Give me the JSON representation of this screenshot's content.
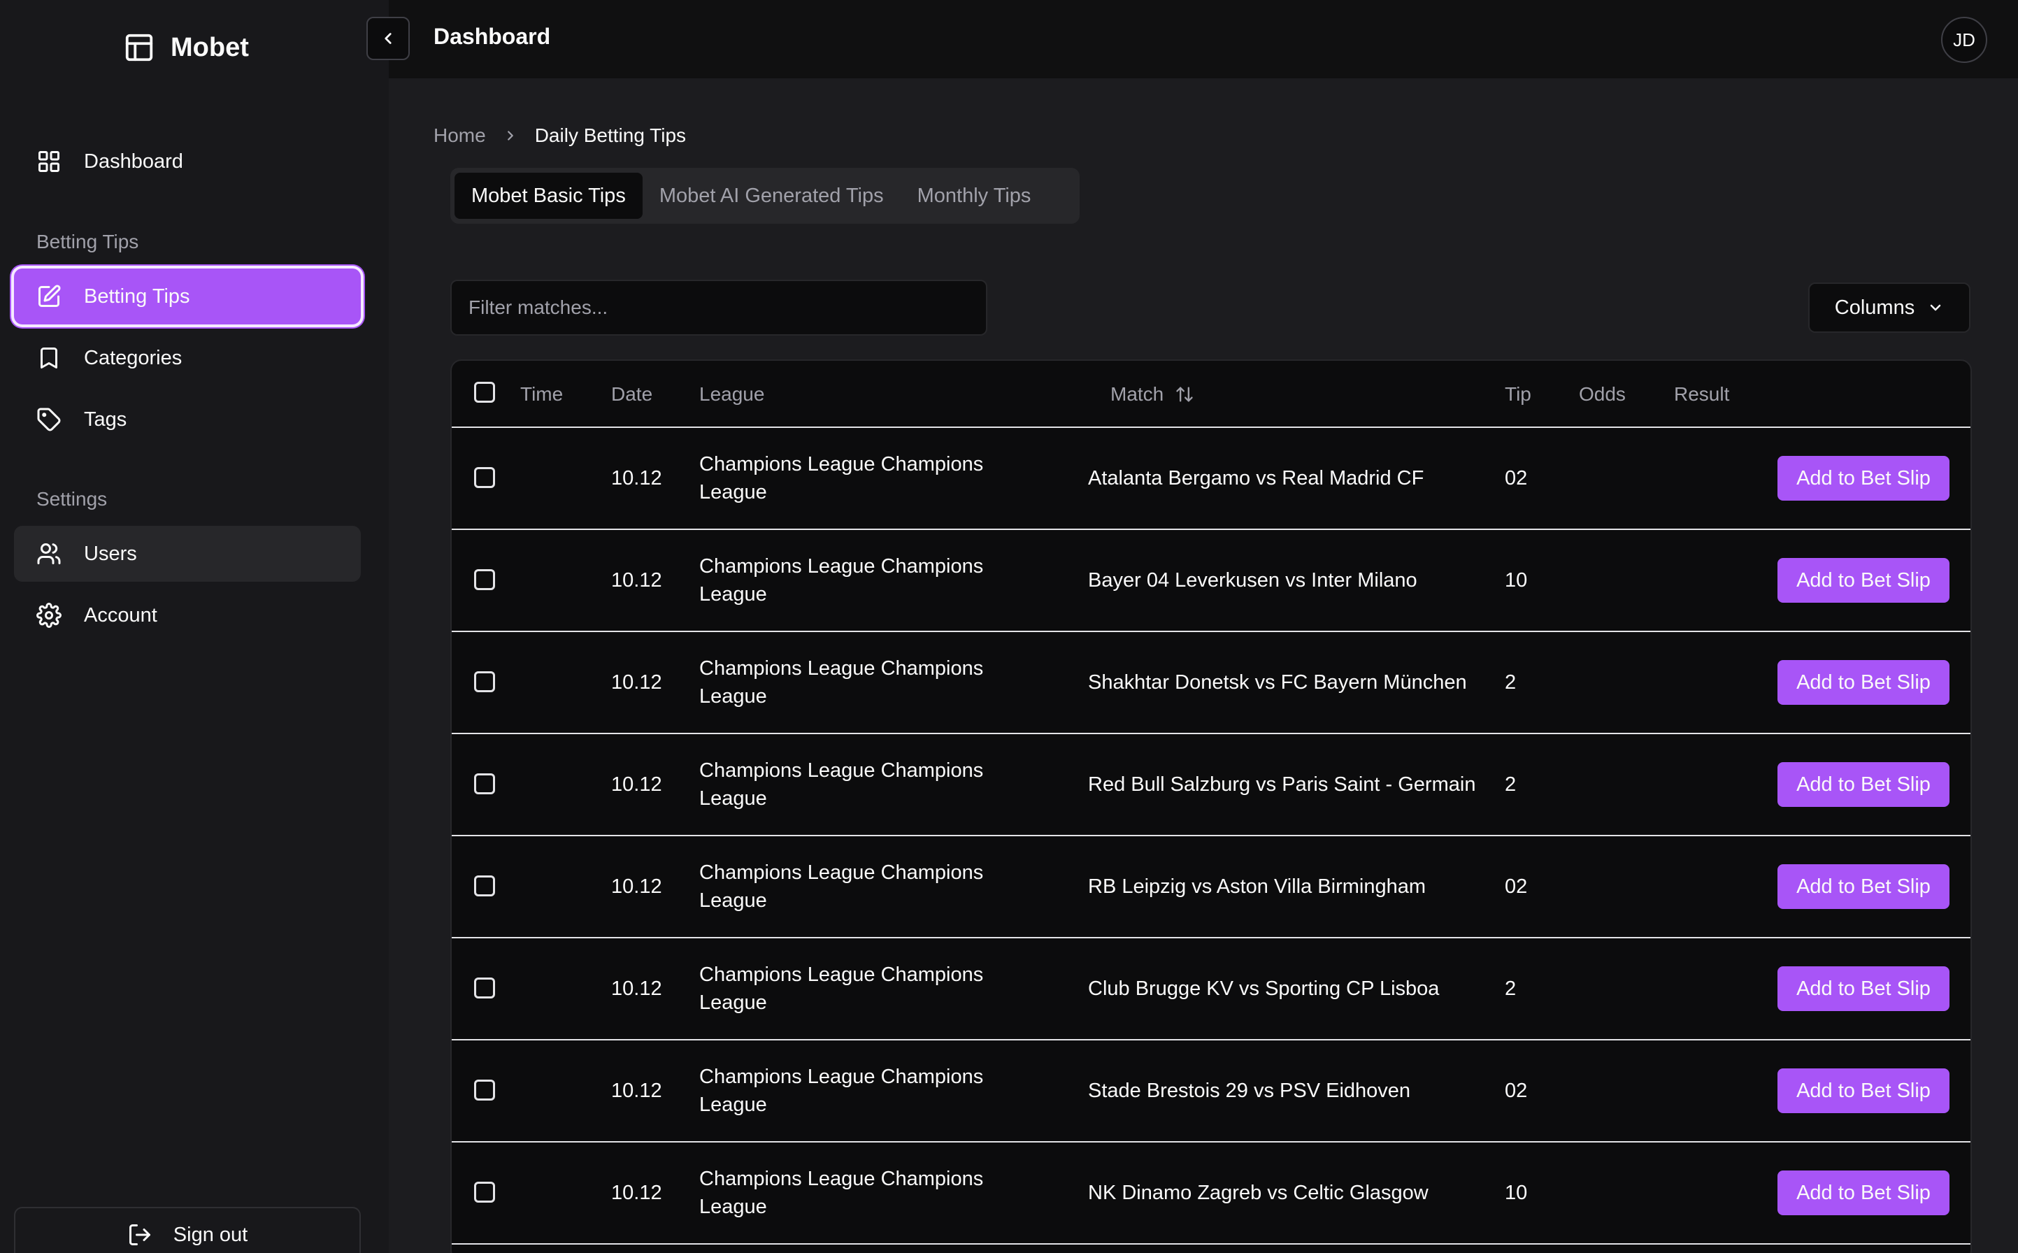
{
  "brand": {
    "name": "Mobet",
    "icon": "layout-panel-icon"
  },
  "sidebar": {
    "dashboard": {
      "label": "Dashboard",
      "icon": "grid-icon"
    },
    "section_betting": "Betting Tips",
    "betting_tips": {
      "label": "Betting Tips",
      "icon": "edit-icon"
    },
    "categories": {
      "label": "Categories",
      "icon": "bookmark-icon"
    },
    "tags": {
      "label": "Tags",
      "icon": "tag-icon"
    },
    "section_settings": "Settings",
    "users": {
      "label": "Users",
      "icon": "users-icon"
    },
    "account": {
      "label": "Account",
      "icon": "gear-icon"
    },
    "signout": {
      "label": "Sign out",
      "icon": "logout-icon"
    }
  },
  "header": {
    "title": "Dashboard",
    "avatar_initials": "JD"
  },
  "breadcrumb": {
    "home": "Home",
    "current": "Daily Betting Tips"
  },
  "tabs": [
    "Mobet Basic Tips",
    "Mobet AI Generated Tips",
    "Monthly Tips"
  ],
  "active_tab": 0,
  "filter": {
    "placeholder": "Filter matches...",
    "value": ""
  },
  "columns_button": "Columns",
  "table": {
    "headers": {
      "time": "Time",
      "date": "Date",
      "league": "League",
      "match": "Match",
      "tip": "Tip",
      "odds": "Odds",
      "result": "Result"
    },
    "action_label": "Add to Bet Slip",
    "rows": [
      {
        "time": "",
        "date": "10.12",
        "league": "Champions League Champions League",
        "match": "Atalanta Bergamo vs Real Madrid CF",
        "tip": "02",
        "odds": "",
        "result": ""
      },
      {
        "time": "",
        "date": "10.12",
        "league": "Champions League Champions League",
        "match": "Bayer 04 Leverkusen vs Inter Milano",
        "tip": "10",
        "odds": "",
        "result": ""
      },
      {
        "time": "",
        "date": "10.12",
        "league": "Champions League Champions League",
        "match": "Shakhtar Donetsk vs FC Bayern München",
        "tip": "2",
        "odds": "",
        "result": ""
      },
      {
        "time": "",
        "date": "10.12",
        "league": "Champions League Champions League",
        "match": "Red Bull Salzburg vs Paris Saint - Germain",
        "tip": "2",
        "odds": "",
        "result": ""
      },
      {
        "time": "",
        "date": "10.12",
        "league": "Champions League Champions League",
        "match": "RB Leipzig vs Aston Villa Birmingham",
        "tip": "02",
        "odds": "",
        "result": ""
      },
      {
        "time": "",
        "date": "10.12",
        "league": "Champions League Champions League",
        "match": "Club Brugge KV vs Sporting CP Lisboa",
        "tip": "2",
        "odds": "",
        "result": ""
      },
      {
        "time": "",
        "date": "10.12",
        "league": "Champions League Champions League",
        "match": "Stade Brestois 29 vs PSV Eidhoven",
        "tip": "02",
        "odds": "",
        "result": ""
      },
      {
        "time": "",
        "date": "10.12",
        "league": "Champions League Champions League",
        "match": "NK Dinamo Zagreb vs Celtic Glasgow",
        "tip": "10",
        "odds": "",
        "result": ""
      }
    ]
  },
  "colors": {
    "accent": "#a855f7",
    "sidebar_bg": "#18181b",
    "main_bg": "#1c1c1f",
    "table_bg": "#0c0c0d"
  }
}
